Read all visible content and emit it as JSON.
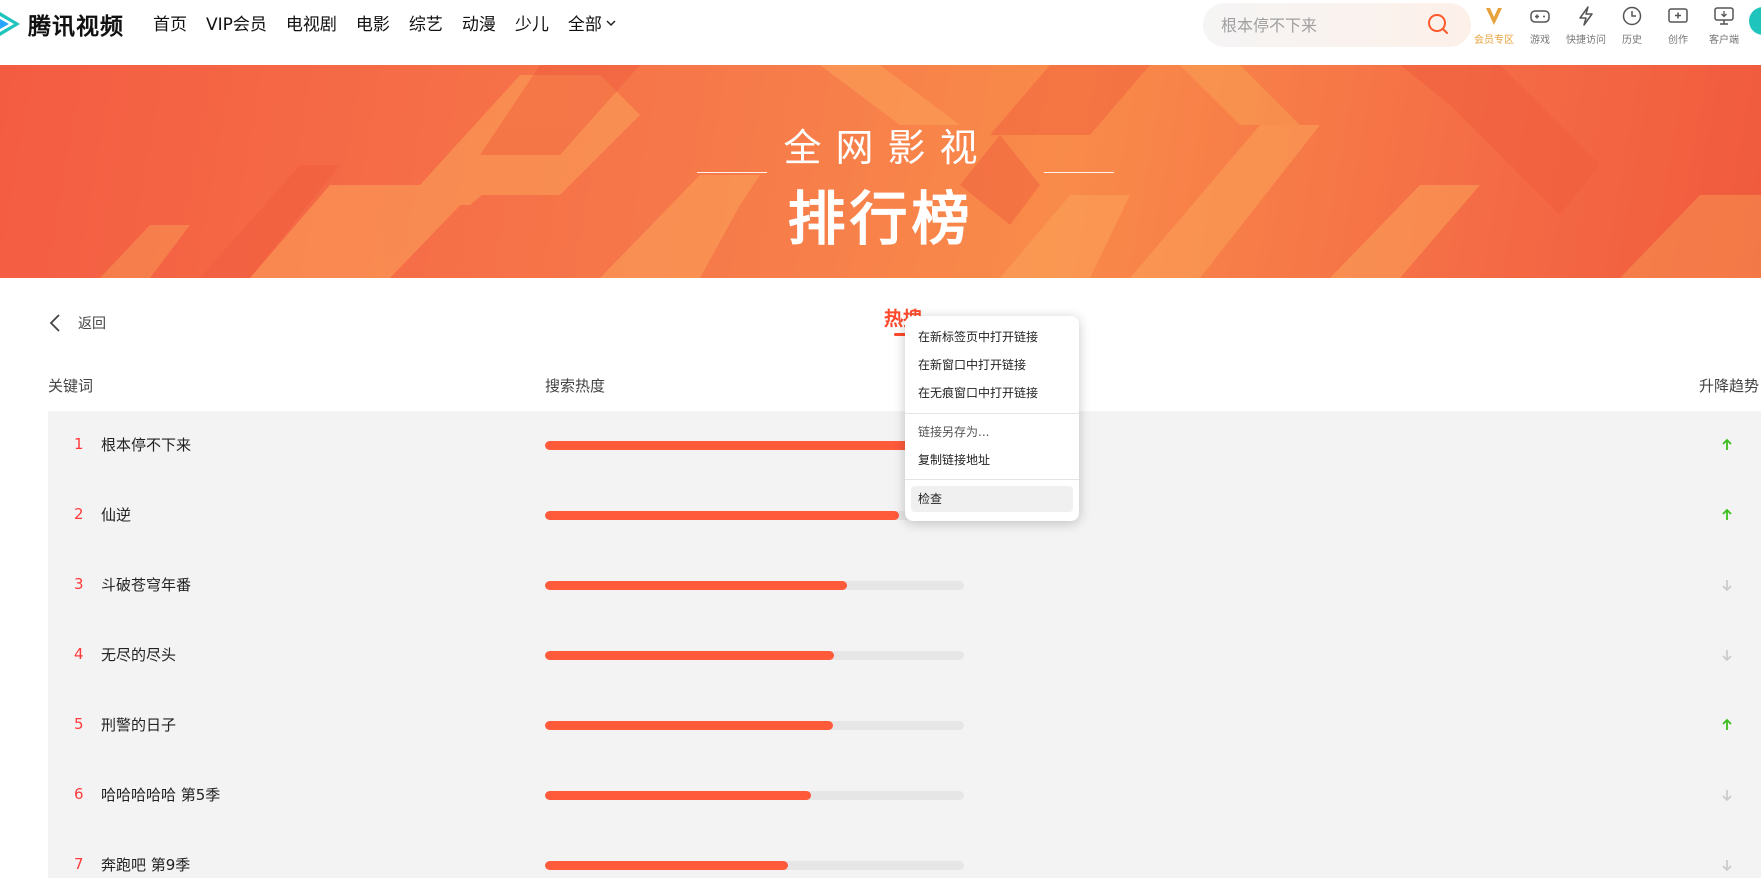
{
  "header": {
    "logo_text": "腾讯视频",
    "nav": [
      "首页",
      "VIP会员",
      "电视剧",
      "电影",
      "综艺",
      "动漫",
      "少儿",
      "全部"
    ],
    "search_placeholder": "根本停不下来",
    "tools": [
      {
        "label": "会员专区",
        "icon": "vip-v-icon"
      },
      {
        "label": "游戏",
        "icon": "gamepad-icon"
      },
      {
        "label": "快捷访问",
        "icon": "lightning-icon"
      },
      {
        "label": "历史",
        "icon": "clock-icon"
      },
      {
        "label": "创作",
        "icon": "create-icon"
      },
      {
        "label": "客户端",
        "icon": "monitor-icon"
      }
    ],
    "accent_color": "#ff5a2b"
  },
  "banner": {
    "subtitle": "全网影视",
    "title": "排行榜"
  },
  "back_label": "返回",
  "tab": "热搜",
  "columns": {
    "keyword": "关键词",
    "heat": "搜索热度",
    "trend": "升降趋势"
  },
  "rankings": [
    {
      "rank": "1",
      "keyword": "根本停不下来",
      "heat": 0.98,
      "trend": "up"
    },
    {
      "rank": "2",
      "keyword": "仙逆",
      "heat": 0.845,
      "trend": "up"
    },
    {
      "rank": "3",
      "keyword": "斗破苍穹年番",
      "heat": 0.72,
      "trend": "down"
    },
    {
      "rank": "4",
      "keyword": "无尽的尽头",
      "heat": 0.69,
      "trend": "down"
    },
    {
      "rank": "5",
      "keyword": "刑警的日子",
      "heat": 0.687,
      "trend": "up"
    },
    {
      "rank": "6",
      "keyword": "哈哈哈哈哈 第5季",
      "heat": 0.635,
      "trend": "down"
    },
    {
      "rank": "7",
      "keyword": "奔跑吧 第9季",
      "heat": 0.58,
      "trend": "down"
    }
  ],
  "trend_colors": {
    "up": "#3cbf1e",
    "down": "#cccccc"
  },
  "context_menu": {
    "items": [
      "在新标签页中打开链接",
      "在新窗口中打开链接",
      "在无痕窗口中打开链接",
      "链接另存为...",
      "复制链接地址",
      "检查"
    ]
  }
}
